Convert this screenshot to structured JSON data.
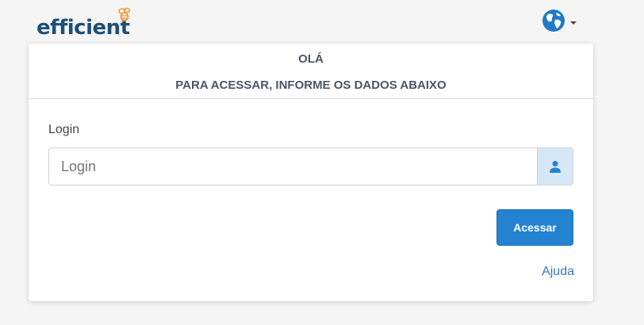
{
  "header": {
    "logo_text": "efficient",
    "language_icon": "globe-icon",
    "language_caret_icon": "caret-down-icon"
  },
  "card": {
    "greeting": "OLÁ",
    "subtitle": "PARA ACESSAR, INFORME OS DADOS ABAIXO",
    "login_label": "Login",
    "login_placeholder": "Login",
    "login_value": "",
    "login_addon_icon": "user-icon",
    "submit_label": "Acessar",
    "help_link": "Ajuda"
  },
  "colors": {
    "brand_text": "#1d4f78",
    "logo_accent": "#f29a38",
    "primary_button": "#2383d1",
    "link": "#3a78c2",
    "addon_background": "#d6e7f5",
    "globe": "#1f7bc8"
  }
}
